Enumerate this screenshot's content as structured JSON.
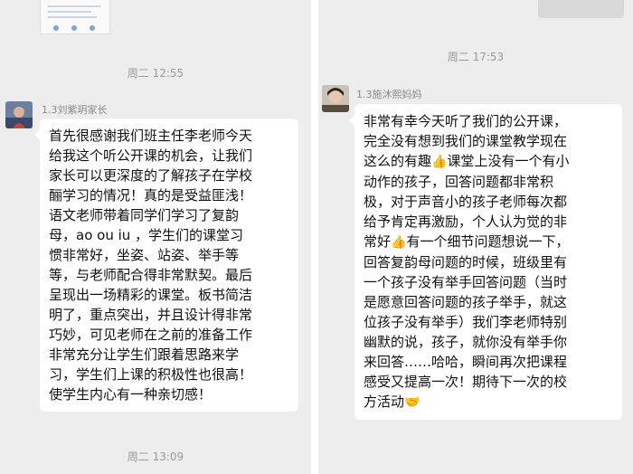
{
  "left": {
    "timestamp_top": "周二 12:55",
    "sender": "1.3刘紫玥家长",
    "message_lines": [
      "首先很感谢我们班主任李老师今天",
      "给我这个听公开课的机会，让我们",
      "家长可以更深度的了解孩子在学校",
      "酾学习的情况！真的是受益匪浅！",
      "语文老师带着同学们学习了复韵",
      "母，ao ou iu ，学生们的课堂习",
      "惯非常好，坐姿、站姿、举手等",
      "等，与老师配合得非常默契。最后",
      "呈现出一场精彩的课堂。板书简洁",
      "明了，重点突出，并且设计得非常",
      "巧妙，可见老师在之前的准备工作",
      "非常充分让学生们跟着思路来学",
      "习，学生们上课的积极性也很高！",
      "使学生内心有一种亲切感！"
    ],
    "timestamp_bottom": "周二 13:09"
  },
  "right": {
    "timestamp_top": "周二 17:53",
    "sender": "1.3施沐熙妈妈",
    "message_lines": [
      {
        "text": "非常有幸今天听了我们的公开课，"
      },
      {
        "text": "完全没有想到我们的课堂教学现在"
      },
      {
        "text": "这么的有趣",
        "emoji": "👍",
        "after": "课堂上没有一个有小"
      },
      {
        "text": "动作的孩子，回答问题都非常积"
      },
      {
        "text": "极，对于声音小的孩子老师每次都"
      },
      {
        "text": "给予肯定再激励，个人认为觉的非"
      },
      {
        "text": "常好",
        "emoji": "👍",
        "after": "有一个细节问题想说一下，"
      },
      {
        "text": "回答复韵母问题的时候，班级里有"
      },
      {
        "text": "一个孩子没有举手回答问题（当时"
      },
      {
        "text": "是愿意回答问题的孩子举手，就这"
      },
      {
        "text": "位孩子没有举手）我们李老师特别"
      },
      {
        "text": "幽默的说，孩子，就你没有举手你"
      },
      {
        "text": "来回答……哈哈，瞬间再次把课程"
      },
      {
        "text": "感受又提高一次！期待下一次的校"
      },
      {
        "text": "方活动",
        "emoji": "🤝",
        "after": ""
      }
    ]
  },
  "colors": {
    "chat_background": "#ededed",
    "bubble": "#ffffff",
    "timestamp": "#9a9a9a",
    "sender_name": "#8a8a8a"
  }
}
